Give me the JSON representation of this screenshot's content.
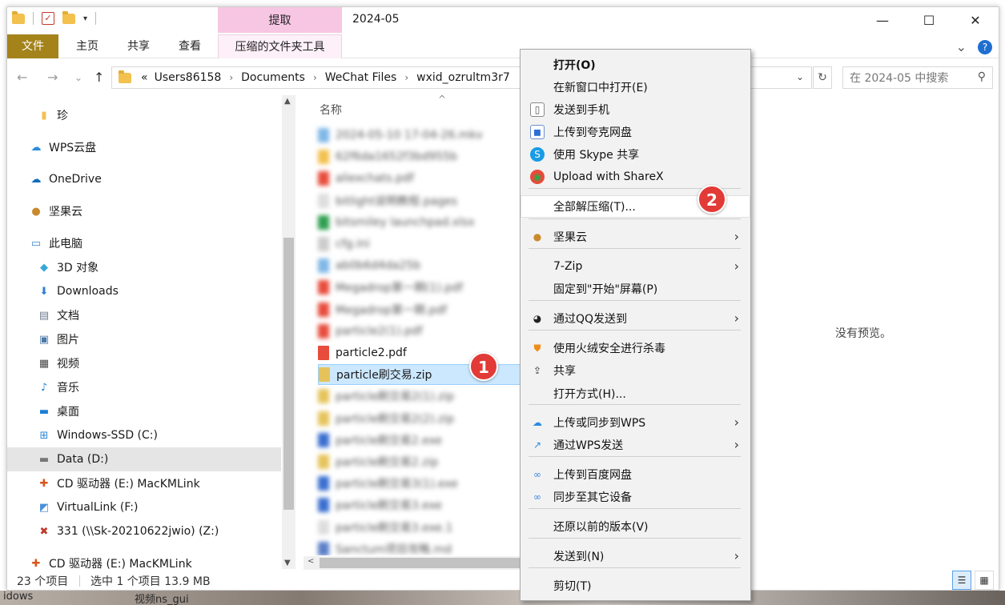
{
  "window": {
    "title": "2024-05",
    "context_tab_group": "提取",
    "controls": {
      "minimize": "—",
      "maximize": "☐",
      "close": "✕"
    }
  },
  "ribbon": {
    "tabs": [
      "文件",
      "主页",
      "共享",
      "查看",
      "压缩的文件夹工具"
    ],
    "collapse_glyph": "⌄",
    "help_glyph": "?"
  },
  "address": {
    "overflow": "«",
    "crumbs": [
      "Users86158",
      "Documents",
      "WeChat Files",
      "wxid_ozrultm3r7"
    ],
    "dropdown_glyph": "⌄",
    "refresh_glyph": "↻",
    "search_placeholder": "在 2024-05 中搜索",
    "search_glyph": "⚲"
  },
  "nav": {
    "back": "←",
    "forward": "→",
    "recent": "⌄",
    "up": "↑",
    "items": [
      {
        "label": "珍",
        "icon": "folder-icon",
        "indent": 1
      },
      {
        "label": "WPS云盘",
        "icon": "wps-cloud-icon",
        "indent": 0
      },
      {
        "label": "OneDrive",
        "icon": "onedrive-icon",
        "indent": 0
      },
      {
        "label": "坚果云",
        "icon": "nutstore-icon",
        "indent": 0
      },
      {
        "label": "此电脑",
        "icon": "this-pc-icon",
        "indent": 0
      },
      {
        "label": "3D 对象",
        "icon": "3d-objects-icon",
        "indent": 1
      },
      {
        "label": "Downloads",
        "icon": "downloads-icon",
        "indent": 1
      },
      {
        "label": "文档",
        "icon": "documents-icon",
        "indent": 1
      },
      {
        "label": "图片",
        "icon": "pictures-icon",
        "indent": 1
      },
      {
        "label": "视频",
        "icon": "videos-icon",
        "indent": 1
      },
      {
        "label": "音乐",
        "icon": "music-icon",
        "indent": 1
      },
      {
        "label": "桌面",
        "icon": "desktop-icon",
        "indent": 1
      },
      {
        "label": "Windows-SSD (C:)",
        "icon": "windows-drive-icon",
        "indent": 1
      },
      {
        "label": "Data (D:)",
        "icon": "drive-icon",
        "indent": 1,
        "selected": true
      },
      {
        "label": "CD 驱动器 (E:) MacKMLink",
        "icon": "cd-drive-icon",
        "indent": 1
      },
      {
        "label": "VirtualLink (F:)",
        "icon": "virtual-drive-icon",
        "indent": 1
      },
      {
        "label": "331 (\\\\Sk-20210622jwio) (Z:)",
        "icon": "network-drive-icon",
        "indent": 1
      },
      {
        "label": "CD 驱动器 (E:) MacKMLink",
        "icon": "cd-drive-icon",
        "indent": 0
      }
    ]
  },
  "files": {
    "column_name": "名称",
    "sort_glyph": "^",
    "rows": [
      {
        "label": "2024-05-10 17-04-26.mkv",
        "blur": true,
        "color": "#7fb7e6"
      },
      {
        "label": "62f6da1652f3bd955b",
        "blur": true,
        "color": "#f2c14e"
      },
      {
        "label": "aliexchats.pdf",
        "blur": true,
        "color": "#e74c3c"
      },
      {
        "label": "bitlight说明教程.pages",
        "blur": true,
        "color": "#dddddd"
      },
      {
        "label": "bitsmiley launchpad.xlsx",
        "blur": true,
        "color": "#2e9e4f"
      },
      {
        "label": "cfg.ini",
        "blur": true,
        "color": "#cccccc"
      },
      {
        "label": "ab0b6d4da25b",
        "blur": true,
        "color": "#7fb7e6"
      },
      {
        "label": "Megadrop第一期(1).pdf",
        "blur": true,
        "color": "#e74c3c"
      },
      {
        "label": "Megadrop第一期.pdf",
        "blur": true,
        "color": "#e74c3c"
      },
      {
        "label": "particle2(1).pdf",
        "blur": true,
        "color": "#e74c3c"
      },
      {
        "label": "particle2.pdf",
        "blur": false,
        "color": "#e74c3c"
      },
      {
        "label": "particle刷交易.zip",
        "blur": false,
        "color": "#e6c35a",
        "selected": true
      },
      {
        "label": "particle刷交易2(1).zip",
        "blur": true,
        "color": "#e6c35a"
      },
      {
        "label": "particle刷交易2(2).zip",
        "blur": true,
        "color": "#e6c35a"
      },
      {
        "label": "particle刷交易2.exe",
        "blur": true,
        "color": "#3a6fd0"
      },
      {
        "label": "particle刷交易2.zip",
        "blur": true,
        "color": "#e6c35a"
      },
      {
        "label": "particle刷交易3(1).exe",
        "blur": true,
        "color": "#3a6fd0"
      },
      {
        "label": "particle刷交易3.exe",
        "blur": true,
        "color": "#3a6fd0"
      },
      {
        "label": "particle刷交易3.exe.1",
        "blur": true,
        "color": "#dddddd"
      },
      {
        "label": "Sanctum项目攻略.md",
        "blur": true,
        "color": "#5b7fc7"
      }
    ],
    "hscroll_left": "<"
  },
  "preview": {
    "text": "没有预览。"
  },
  "status": {
    "count": "23 个项目",
    "selection": "选中 1 个项目  13.9 MB",
    "view_details": "☰",
    "view_tiles": "▦"
  },
  "badges": {
    "one": "1",
    "two": "2"
  },
  "context_menu": {
    "items": [
      {
        "label": "打开(O)",
        "bold": true,
        "icon": "",
        "sub": false
      },
      {
        "label": "在新窗口中打开(E)",
        "icon": "",
        "sub": false
      },
      {
        "label": "发送到手机",
        "icon": "phone-document-icon",
        "sub": false
      },
      {
        "label": "上传到夸克网盘",
        "icon": "quark-drive-icon",
        "sub": false
      },
      {
        "label": "使用 Skype 共享",
        "icon": "skype-icon",
        "sub": false
      },
      {
        "label": "Upload with ShareX",
        "icon": "sharex-icon",
        "sub": false
      },
      {
        "label": "全部解压缩(T)...",
        "icon": "",
        "sub": false,
        "hover": true
      },
      {
        "label": "坚果云",
        "icon": "nutstore-icon",
        "sub": true
      },
      {
        "label": "7-Zip",
        "icon": "",
        "sub": true
      },
      {
        "label": "固定到\"开始\"屏幕(P)",
        "icon": "",
        "sub": false
      },
      {
        "label": "通过QQ发送到",
        "icon": "qq-icon",
        "sub": true
      },
      {
        "label": "使用火绒安全进行杀毒",
        "icon": "huorong-shield-icon",
        "sub": false
      },
      {
        "label": "共享",
        "icon": "share-icon",
        "sub": false
      },
      {
        "label": "打开方式(H)...",
        "icon": "",
        "sub": false
      },
      {
        "label": "上传或同步到WPS",
        "icon": "wps-cloud-icon",
        "sub": true
      },
      {
        "label": "通过WPS发送",
        "icon": "wps-send-icon",
        "sub": true
      },
      {
        "label": "上传到百度网盘",
        "icon": "baidu-netdisk-icon",
        "sub": false
      },
      {
        "label": "同步至其它设备",
        "icon": "baidu-sync-icon",
        "sub": false
      },
      {
        "label": "还原以前的版本(V)",
        "icon": "",
        "sub": false
      },
      {
        "label": "发送到(N)",
        "icon": "",
        "sub": true
      },
      {
        "label": "剪切(T)",
        "icon": "",
        "sub": false
      }
    ],
    "submenu_glyph": "›"
  },
  "desktop": {
    "left_text": "idows",
    "mid_text": "视频ns_gui"
  }
}
